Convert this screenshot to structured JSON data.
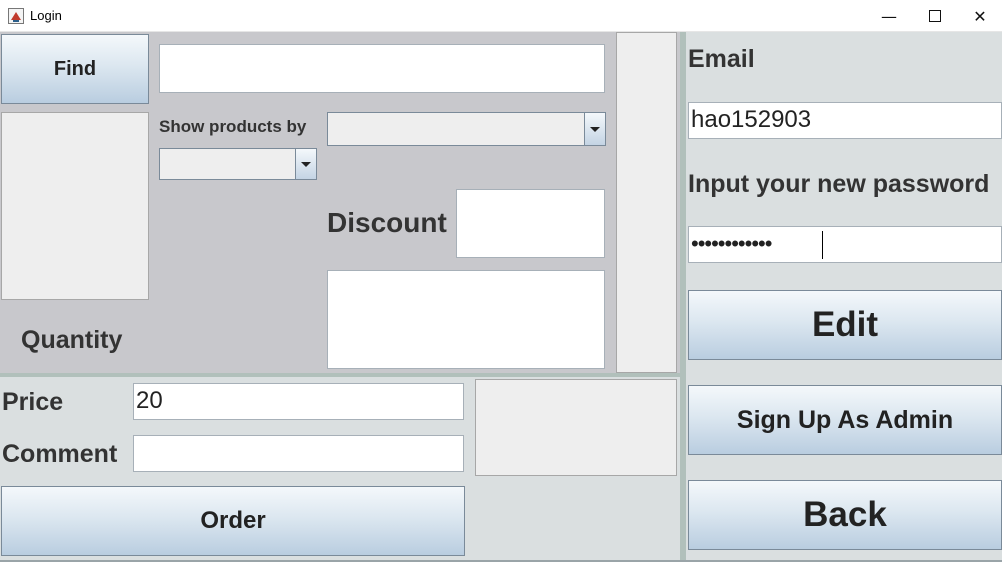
{
  "window": {
    "title": "Login"
  },
  "search": {
    "find_label": "Find",
    "value": ""
  },
  "filter": {
    "show_products_label": "Show products by",
    "primary_value": "",
    "secondary_value": ""
  },
  "discount": {
    "label": "Discount",
    "value": ""
  },
  "quantity": {
    "label": "Quantity"
  },
  "price": {
    "label": "Price",
    "value": "20"
  },
  "comment": {
    "label": "Comment",
    "value": ""
  },
  "order": {
    "label": "Order"
  },
  "account": {
    "email_label": "Email",
    "email_value": "hao152903",
    "password_label": "Input your new password",
    "password_mask": "••••••••••••"
  },
  "actions": {
    "edit_label": "Edit",
    "signup_admin_label": "Sign Up As Admin",
    "back_label": "Back"
  },
  "icons": {
    "minimize": "minimize-icon",
    "maximize": "maximize-icon",
    "close": "close-icon",
    "dropdown": "chevron-down-icon"
  }
}
